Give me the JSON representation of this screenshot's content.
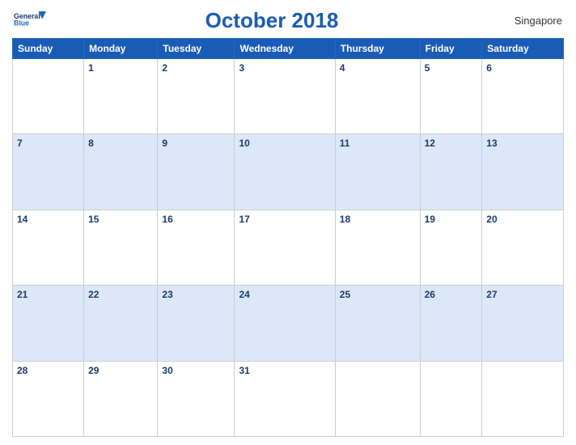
{
  "header": {
    "logo_line1": "General",
    "logo_line2": "Blue",
    "title": "October 2018",
    "country": "Singapore"
  },
  "days_of_week": [
    "Sunday",
    "Monday",
    "Tuesday",
    "Wednesday",
    "Thursday",
    "Friday",
    "Saturday"
  ],
  "weeks": [
    [
      {
        "num": "",
        "empty": true
      },
      {
        "num": "1"
      },
      {
        "num": "2"
      },
      {
        "num": "3"
      },
      {
        "num": "4"
      },
      {
        "num": "5"
      },
      {
        "num": "6"
      }
    ],
    [
      {
        "num": "7"
      },
      {
        "num": "8"
      },
      {
        "num": "9"
      },
      {
        "num": "10"
      },
      {
        "num": "11"
      },
      {
        "num": "12"
      },
      {
        "num": "13"
      }
    ],
    [
      {
        "num": "14"
      },
      {
        "num": "15"
      },
      {
        "num": "16"
      },
      {
        "num": "17"
      },
      {
        "num": "18"
      },
      {
        "num": "19"
      },
      {
        "num": "20"
      }
    ],
    [
      {
        "num": "21"
      },
      {
        "num": "22"
      },
      {
        "num": "23"
      },
      {
        "num": "24"
      },
      {
        "num": "25"
      },
      {
        "num": "26"
      },
      {
        "num": "27"
      }
    ],
    [
      {
        "num": "28"
      },
      {
        "num": "29"
      },
      {
        "num": "30"
      },
      {
        "num": "31"
      },
      {
        "num": "",
        "empty": true
      },
      {
        "num": "",
        "empty": true
      },
      {
        "num": "",
        "empty": true
      }
    ]
  ]
}
